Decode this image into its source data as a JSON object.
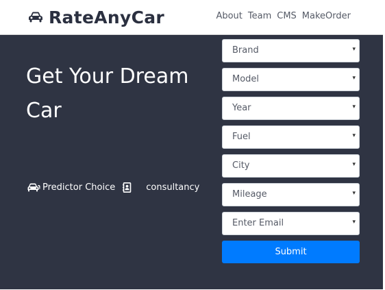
{
  "navbar": {
    "brand": "RateAnyCar",
    "brand_icon": "car-icon",
    "links": [
      "About",
      "Team",
      "CMS",
      "MakeOrder"
    ]
  },
  "hero": {
    "title": "Get Your Dream Car",
    "features": [
      {
        "icon": "car-pair-icon",
        "label": "Predictor Choice"
      },
      {
        "icon": "contact-book-icon",
        "label": "consultancy"
      }
    ]
  },
  "form": {
    "fields": [
      "Brand",
      "Model",
      "Year",
      "Fuel",
      "City",
      "Mileage",
      "Enter Email"
    ],
    "caret": "▾",
    "submit_label": "Submit"
  },
  "colors": {
    "hero_bg": "#2f3443",
    "brand_text": "#2b3040",
    "submit_bg": "#007bff"
  }
}
